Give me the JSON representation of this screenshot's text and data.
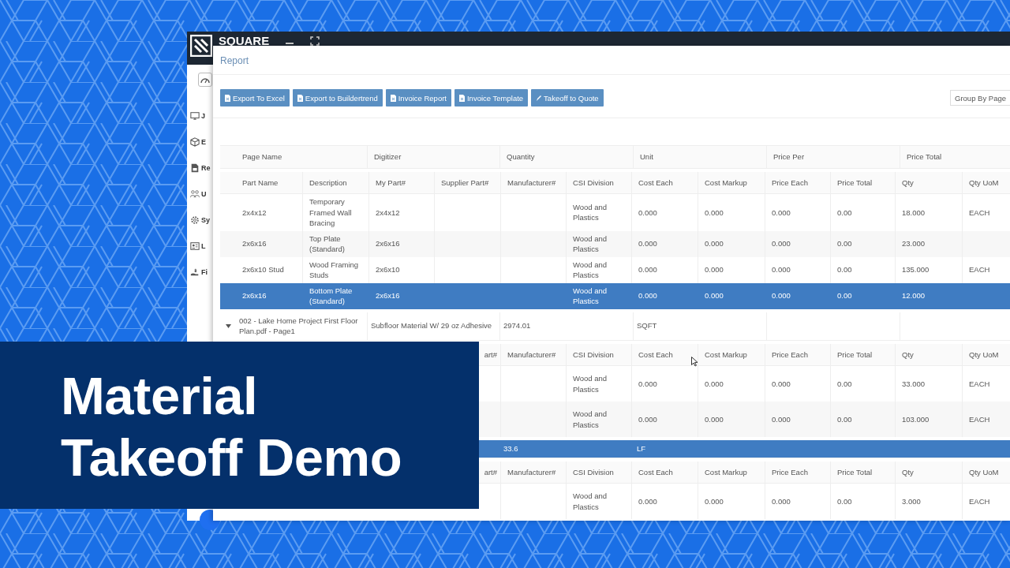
{
  "app": {
    "logo": "SQUARE",
    "sidebar": [
      {
        "label": "J"
      },
      {
        "label": "E"
      },
      {
        "label": "Re"
      },
      {
        "label": "U"
      },
      {
        "label": "Sy"
      },
      {
        "label": "L"
      },
      {
        "label": "Fi"
      }
    ]
  },
  "report": {
    "title": "Report",
    "toolbar": [
      "Export To Excel",
      "Export to Buildertrend",
      "Invoice Report",
      "Invoice Template",
      "Takeoff to Quote"
    ],
    "group_by": "Group By Page",
    "table": {
      "columns": [
        "Page Name",
        "Digitizer",
        "Quantity",
        "Unit",
        "Price Per",
        "Price Total"
      ],
      "sections": [
        {
          "sub_columns": [
            "Part Name",
            "Description",
            "My Part#",
            "Supplier Part#",
            "Manufacturer#",
            "CSI Division",
            "Cost Each",
            "Cost Markup",
            "Price Each",
            "Price Total",
            "Qty",
            "Qty UoM"
          ],
          "rows": [
            {
              "selected": false,
              "cells": [
                "2x4x12",
                "Temporary Framed Wall Bracing",
                "2x4x12",
                null,
                null,
                "Wood and Plastics",
                "0.000",
                "0.000",
                "0.000",
                "0.00",
                "18.000",
                "EACH"
              ]
            },
            {
              "selected": false,
              "cells": [
                "2x6x16",
                "Top Plate (Standard)",
                "2x6x16",
                null,
                null,
                "Wood and Plastics",
                "0.000",
                "0.000",
                "0.000",
                "0.00",
                "23.000",
                null
              ]
            },
            {
              "selected": false,
              "cells": [
                "2x6x10 Stud",
                "Wood Framing Studs",
                "2x6x10",
                null,
                null,
                "Wood and Plastics",
                "0.000",
                "0.000",
                "0.000",
                "0.00",
                "135.000",
                "EACH"
              ]
            },
            {
              "selected": true,
              "cells": [
                "2x6x16",
                "Bottom Plate (Standard)",
                "2x6x16",
                null,
                null,
                "Wood and Plastics",
                "0.000",
                "0.000",
                "0.000",
                "0.00",
                "12.000",
                null
              ]
            }
          ]
        },
        {
          "group": {
            "expanded": true,
            "selected": false,
            "cells": [
              "002 - Lake Home Project First Floor Plan.pdf - Page1",
              "Subfloor Material W/ 29 oz Adhesive",
              "2974.01",
              "SQFT",
              null,
              null
            ]
          },
          "sub_columns": [
            null,
            null,
            null,
            "art#",
            "Manufacturer#",
            "CSI Division",
            "Cost Each",
            "Cost Markup",
            "Price Each",
            "Price Total",
            "Qty",
            "Qty UoM"
          ],
          "rows": [
            {
              "selected": false,
              "cells": [
                null,
                null,
                null,
                null,
                null,
                "Wood and Plastics",
                "0.000",
                "0.000",
                "0.000",
                "0.00",
                "33.000",
                "EACH"
              ]
            },
            {
              "selected": false,
              "cells": [
                null,
                null,
                null,
                null,
                null,
                "Wood and Plastics",
                "0.000",
                "0.000",
                "0.000",
                "0.00",
                "103.000",
                "EACH"
              ]
            }
          ]
        },
        {
          "group": {
            "selected": true,
            "cells": [
              null,
              null,
              "33.6",
              "LF",
              null,
              null
            ]
          },
          "sub_columns": [
            null,
            null,
            null,
            "art#",
            "Manufacturer#",
            "CSI Division",
            "Cost Each",
            "Cost Markup",
            "Price Each",
            "Price Total",
            "Qty",
            "Qty UoM"
          ],
          "rows": [
            {
              "selected": false,
              "cells": [
                null,
                null,
                null,
                null,
                null,
                "Wood and Plastics",
                "0.000",
                "0.000",
                "0.000",
                "0.00",
                "3.000",
                "EACH"
              ]
            }
          ]
        }
      ]
    }
  },
  "banner": {
    "title": "Material Takeoff Demo"
  }
}
